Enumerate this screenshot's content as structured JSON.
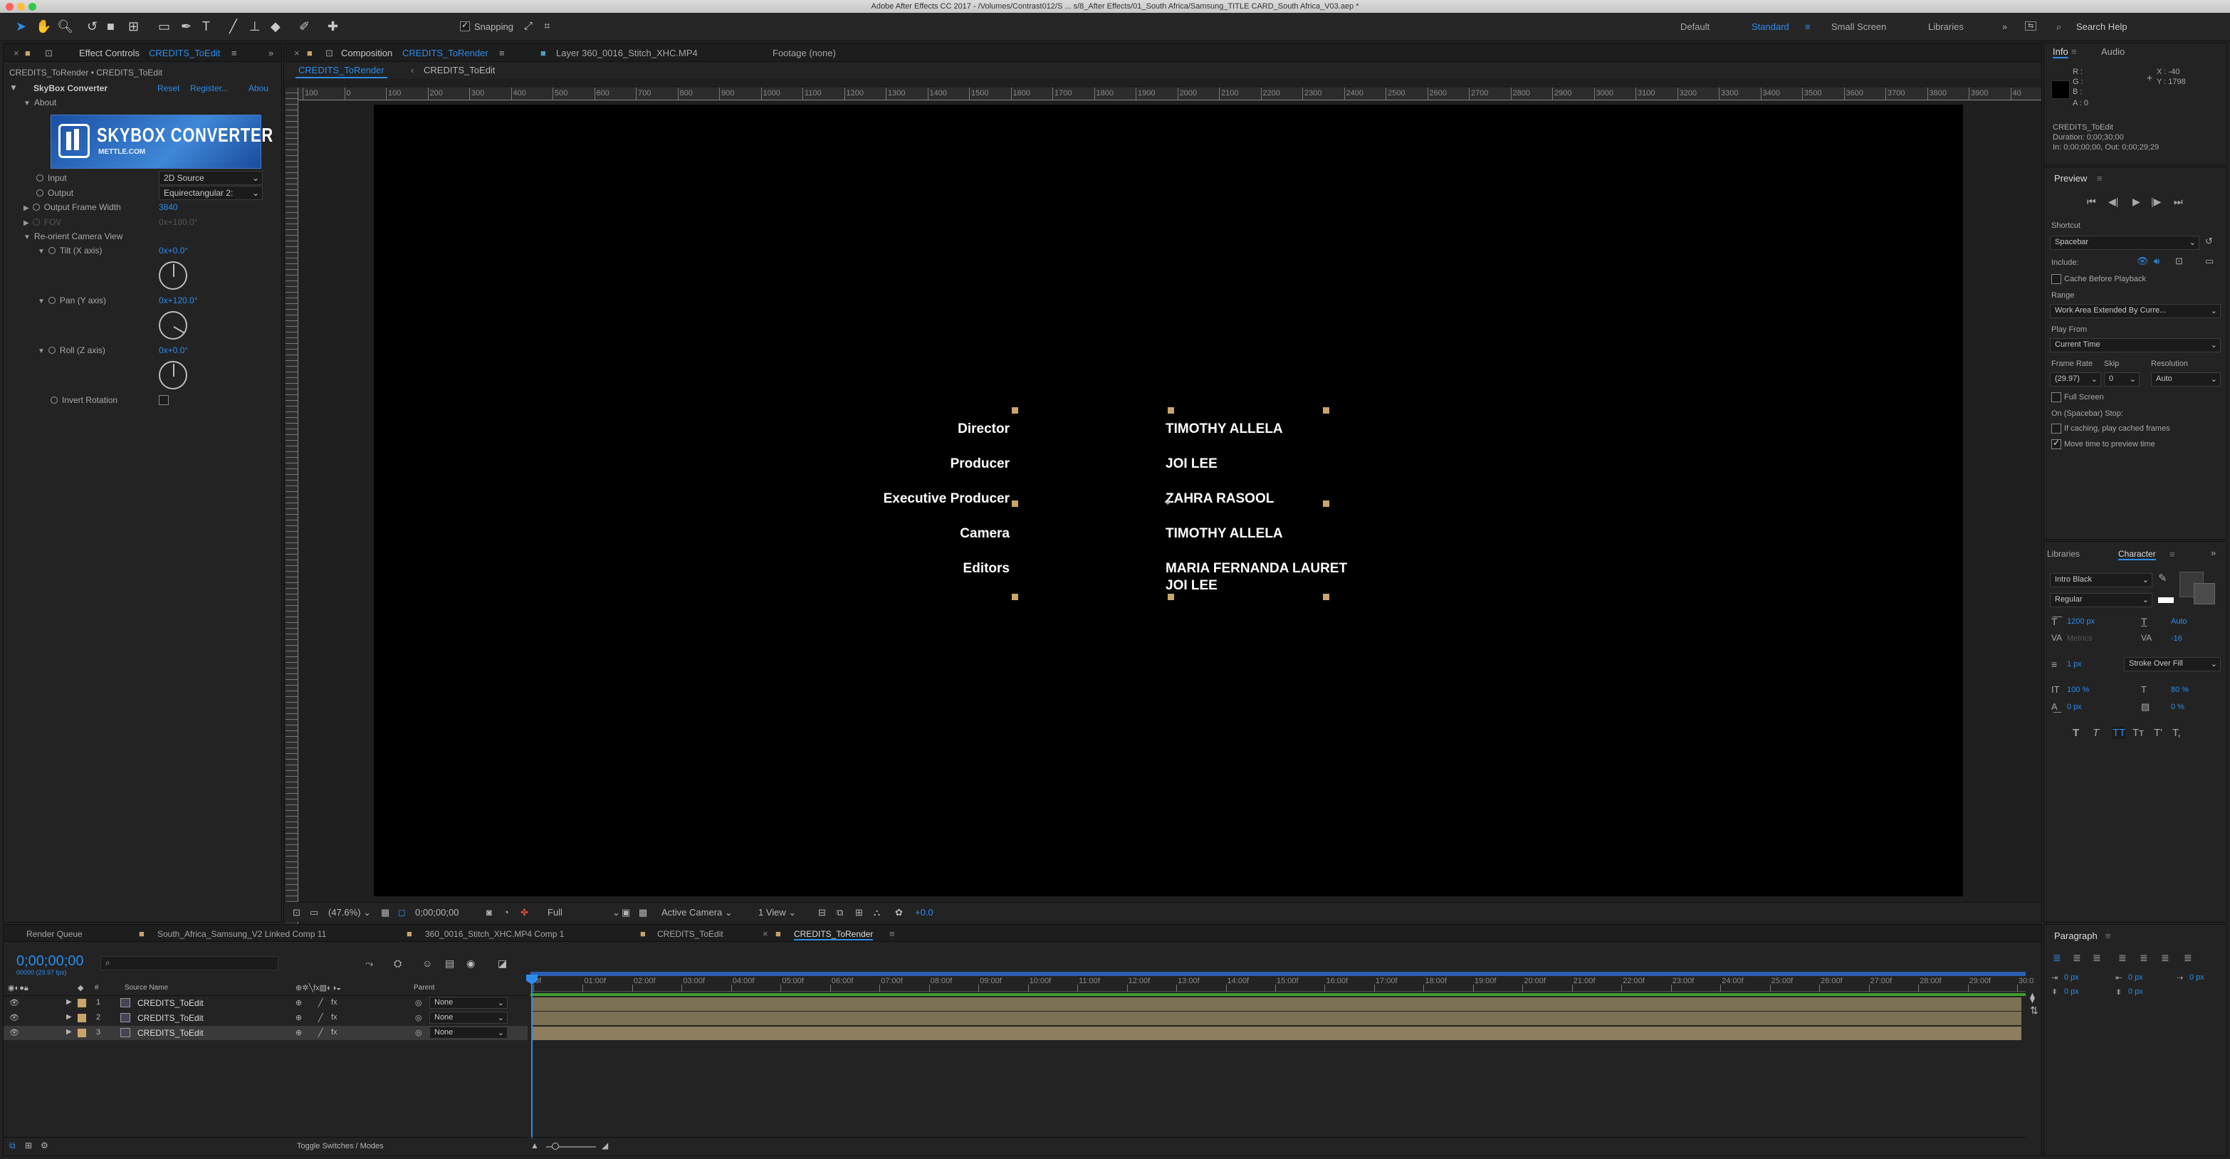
{
  "title": "Adobe After Effects CC 2017 - /Volumes/Contrast012/S ... s/8_After Effects/01_South Africa/Samsung_TITLE CARD_South Africa_V03.aep *",
  "workspaces": [
    "Default",
    "Standard",
    "Small Screen",
    "Libraries"
  ],
  "search_help": "Search Help",
  "toolbar": {
    "snapping": "Snapping"
  },
  "effect_controls": {
    "tab": "Effect Controls",
    "tab_target": "CREDITS_ToEdit",
    "breadcrumb": "CREDITS_ToRender • CREDITS_ToEdit",
    "effect_name": "SkyBox Converter",
    "reset": "Reset",
    "register": "Register...",
    "about_link": "Abou",
    "about": "About",
    "logo_title": "SKYBOX CONVERTER",
    "logo_sub": "METTLE.COM",
    "input_label": "Input",
    "input_value": "2D Source",
    "output_label": "Output",
    "output_value": "Equirectangular 2:",
    "ofw_label": "Output Frame Width",
    "ofw_value": "3840",
    "fov_label": "FOV",
    "fov_value": "0x+180.0°",
    "reorient": "Re-orient Camera View",
    "tilt_label": "Tilt (X axis)",
    "tilt_value": "0x+0.0°",
    "pan_label": "Pan (Y axis)",
    "pan_value": "0x+120.0°",
    "roll_label": "Roll (Z axis)",
    "roll_value": "0x+0.0°",
    "invert": "Invert Rotation"
  },
  "comp": {
    "tab_prefix": "Composition",
    "tab_name": "CREDITS_ToRender",
    "layer_tab": "Layer 360_0016_Stitch_XHC.MP4",
    "footage_tab": "Footage (none)",
    "sub_active": "CREDITS_ToRender",
    "sub_other": "CREDITS_ToEdit",
    "ruler_labels": [
      "100",
      "0",
      "100",
      "200",
      "300",
      "400",
      "500",
      "600",
      "700",
      "800",
      "900",
      "1000",
      "1100",
      "1200",
      "1300",
      "1400",
      "1500",
      "1600",
      "1700",
      "1800",
      "1900",
      "2000",
      "2100",
      "2200",
      "2300",
      "2400",
      "2500",
      "2600",
      "2700",
      "2800",
      "2900",
      "3000",
      "3100",
      "3200",
      "3300",
      "3400",
      "3500",
      "3600",
      "3700",
      "3800",
      "3900",
      "40"
    ],
    "credits": [
      {
        "role": "Director",
        "names": [
          "TIMOTHY ALLELA"
        ]
      },
      {
        "role": "Producer",
        "names": [
          "JOI LEE"
        ]
      },
      {
        "role": "Executive Producer",
        "names": [
          "ZAHRA RASOOL"
        ]
      },
      {
        "role": "Camera",
        "names": [
          "TIMOTHY ALLELA"
        ]
      },
      {
        "role": "Editors",
        "names": [
          "MARIA FERNANDA LAURET",
          "JOI LEE"
        ]
      }
    ],
    "footer": {
      "zoom": "(47.6%)",
      "time": "0;00;00;00",
      "resolution": "Full",
      "camera": "Active Camera",
      "views": "1 View",
      "exposure": "+0.0"
    }
  },
  "info": {
    "tab": "Info",
    "audio_tab": "Audio",
    "r": "R :",
    "g": "G :",
    "b": "B :",
    "a": "A : 0",
    "x": "X : -40",
    "y": "Y : 1798",
    "layer": "CREDITS_ToEdit",
    "duration": "Duration: 0;00;30;00",
    "inout": "In: 0;00;00;00, Out: 0;00;29;29"
  },
  "preview": {
    "tab": "Preview",
    "shortcut_label": "Shortcut",
    "shortcut": "Spacebar",
    "include": "Include:",
    "cache": "Cache Before Playback",
    "range_label": "Range",
    "range": "Work Area Extended By Curre...",
    "play_from_label": "Play From",
    "play_from": "Current Time",
    "frame_rate_label": "Frame Rate",
    "skip_label": "Skip",
    "resolution_label": "Resolution",
    "frame_rate": "(29.97)",
    "skip": "0",
    "resolution": "Auto",
    "full_screen": "Full Screen",
    "stop_label": "On (Spacebar) Stop:",
    "if_caching": "If caching, play cached frames",
    "move_time": "Move time to preview time"
  },
  "character": {
    "libraries_tab": "Libraries",
    "tab": "Character",
    "font": "Intro Black",
    "style": "Regular",
    "size": "1200 px",
    "leading": "Auto",
    "kerning": "Metrics",
    "tracking": "-16",
    "stroke": "1 px",
    "stroke_mode": "Stroke Over Fill",
    "vscale": "100 %",
    "hscale": "80 %",
    "baseline": "0 px",
    "tsume": "0 %",
    "styles": [
      "T",
      "T",
      "TT",
      "Tт",
      "T'",
      "T,"
    ]
  },
  "paragraph": {
    "tab": "Paragraph",
    "indent_left": "0 px",
    "indent_right": "0 px",
    "first_line": "0 px",
    "space_before": "0 px",
    "space_after": "0 px"
  },
  "timeline": {
    "tabs": [
      "Render Queue",
      "South_Africa_Samsung_V2 Linked Comp 11",
      "360_0016_Stitch_XHC.MP4 Comp 1",
      "CREDITS_ToEdit",
      "CREDITS_ToRender"
    ],
    "timecode": "0;00;00;00",
    "fps": "00000 (29.97 fps)",
    "col_source": "Source Name",
    "col_parent": "Parent",
    "layers": [
      {
        "num": "1",
        "name": "CREDITS_ToEdit",
        "parent": "None"
      },
      {
        "num": "2",
        "name": "CREDITS_ToEdit",
        "parent": "None"
      },
      {
        "num": "3",
        "name": "CREDITS_ToEdit",
        "parent": "None"
      }
    ],
    "ticks": [
      "0f",
      "01:00f",
      "02:00f",
      "03:00f",
      "04:00f",
      "05:00f",
      "06:00f",
      "07:00f",
      "08:00f",
      "09:00f",
      "10:00f",
      "11:00f",
      "12:00f",
      "13:00f",
      "14:00f",
      "15:00f",
      "16:00f",
      "17:00f",
      "18:00f",
      "19:00f",
      "20:00f",
      "21:00f",
      "22:00f",
      "23:00f",
      "24:00f",
      "25:00f",
      "26:00f",
      "27:00f",
      "28:00f",
      "29:00f",
      "30:0"
    ],
    "toggle": "Toggle Switches / Modes"
  }
}
